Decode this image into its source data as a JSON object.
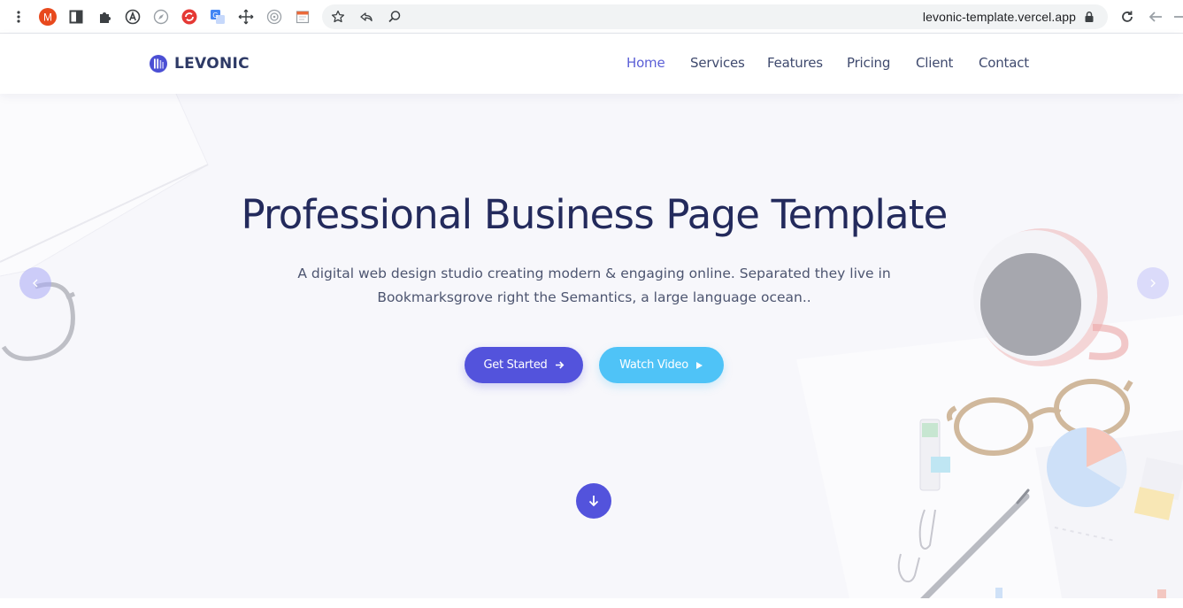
{
  "browser": {
    "url": "levonic-template.vercel.app",
    "extensions": [
      "gmail-extension-icon",
      "sidepanel-icon",
      "puzzle-extensions-icon",
      "a-circle-extension-icon",
      "compass-extension-icon",
      "red-circle-extension-icon",
      "translate-extension-icon",
      "move-cross-extension-icon",
      "target-extension-icon",
      "calendar-extension-icon"
    ],
    "gmail_badge_letter": "M",
    "accent": "#e8491d"
  },
  "site": {
    "brand": "LEVONIC",
    "brand_color": "#2e3a66",
    "nav": [
      {
        "label": "Home",
        "active": true
      },
      {
        "label": "Services",
        "active": false
      },
      {
        "label": "Features",
        "active": false
      },
      {
        "label": "Pricing",
        "active": false
      },
      {
        "label": "Client",
        "active": false
      },
      {
        "label": "Contact",
        "active": false
      }
    ]
  },
  "hero": {
    "title": "Professional Business Page Template",
    "subtitle_line1": "A digital web design studio creating modern & engaging online. Separated they live in",
    "subtitle_line2": "Bookmarksgrove right the Semantics, a large language ocean..",
    "primary_button": "Get Started",
    "secondary_button": "Watch Video",
    "primary_color": "#5353dc",
    "secondary_color": "#4fc3f7"
  }
}
